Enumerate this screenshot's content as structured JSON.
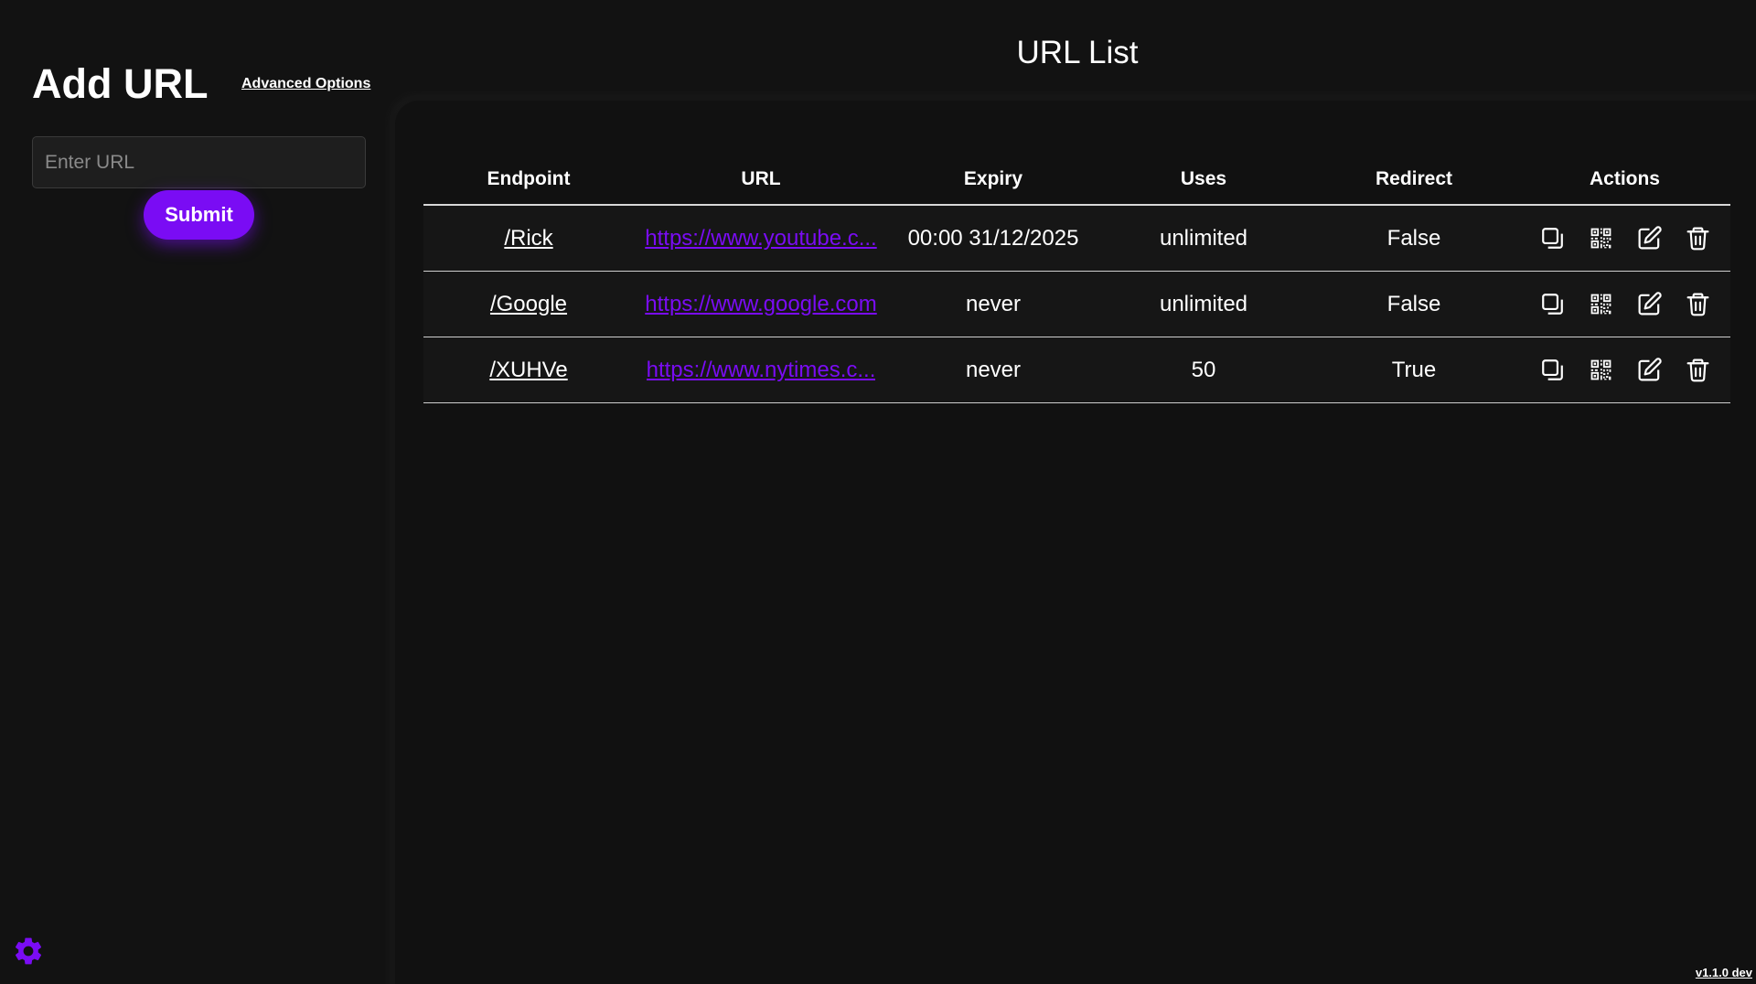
{
  "add_panel": {
    "title": "Add URL",
    "advanced_options": "Advanced Options",
    "url_input": {
      "value": "",
      "placeholder": "Enter URL"
    },
    "submit_label": "Submit"
  },
  "list_panel": {
    "title": "URL List",
    "columns": [
      "Endpoint",
      "URL",
      "Expiry",
      "Uses",
      "Redirect",
      "Actions"
    ],
    "rows": [
      {
        "endpoint": "/Rick",
        "url": "https://www.youtube.c...",
        "expiry": "00:00 31/12/2025",
        "uses": "unlimited",
        "redirect": "False"
      },
      {
        "endpoint": "/Google",
        "url": "https://www.google.com",
        "expiry": "never",
        "uses": "unlimited",
        "redirect": "False"
      },
      {
        "endpoint": "/XUHVe",
        "url": "https://www.nytimes.c...",
        "expiry": "never",
        "uses": "50",
        "redirect": "True"
      }
    ],
    "row_actions": [
      "copy-icon",
      "qr-code-icon",
      "edit-icon",
      "delete-icon"
    ]
  },
  "footer": {
    "version": "v1.1.0 dev",
    "settings_icon": "gear-icon"
  },
  "colors": {
    "background": "#121212",
    "panel": "#111111",
    "accent": "#7a0cf4",
    "text": "#ffffff"
  }
}
